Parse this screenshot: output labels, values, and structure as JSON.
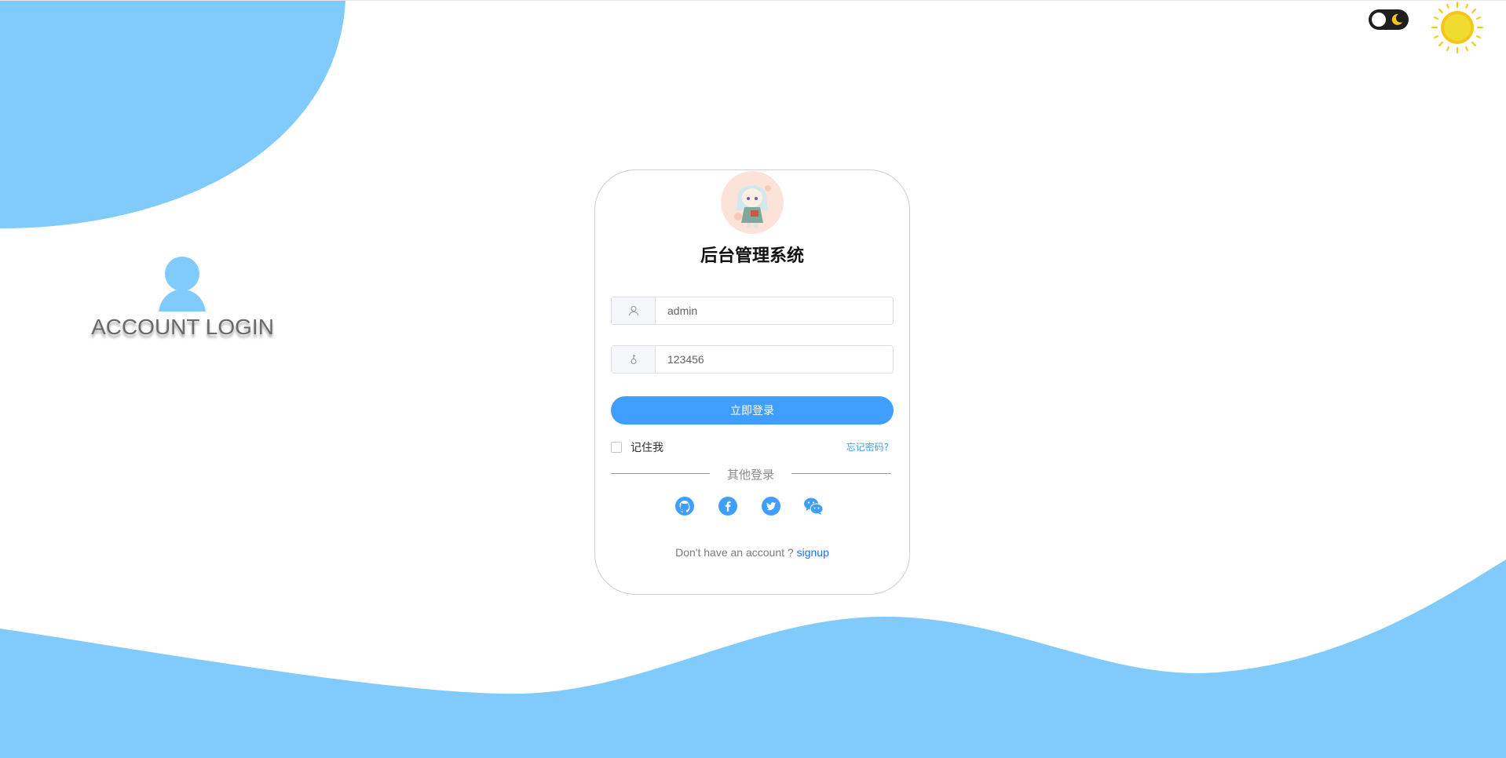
{
  "colors": {
    "accent": "#409eff",
    "blob": "#80cbfc",
    "sun": "#f5c518"
  },
  "left_panel": {
    "heading": "ACCOUNT LOGIN",
    "icon": "user-avatar-icon"
  },
  "header_controls": {
    "theme_toggle_icon": "moon-icon",
    "sun_icon": "sun-icon"
  },
  "login_card": {
    "title": "后台管理系统",
    "username": {
      "value": "admin",
      "icon": "user-icon"
    },
    "password": {
      "value": "123456",
      "icon": "key-icon"
    },
    "login_button": "立即登录",
    "remember_label": "记住我",
    "forgot_link": "忘记密码?",
    "other_login_label": "其他登录",
    "social_icons": [
      "github-icon",
      "facebook-icon",
      "twitter-icon",
      "wechat-icon"
    ],
    "signup_prompt": "Don't have an account ? ",
    "signup_link": "signup"
  }
}
